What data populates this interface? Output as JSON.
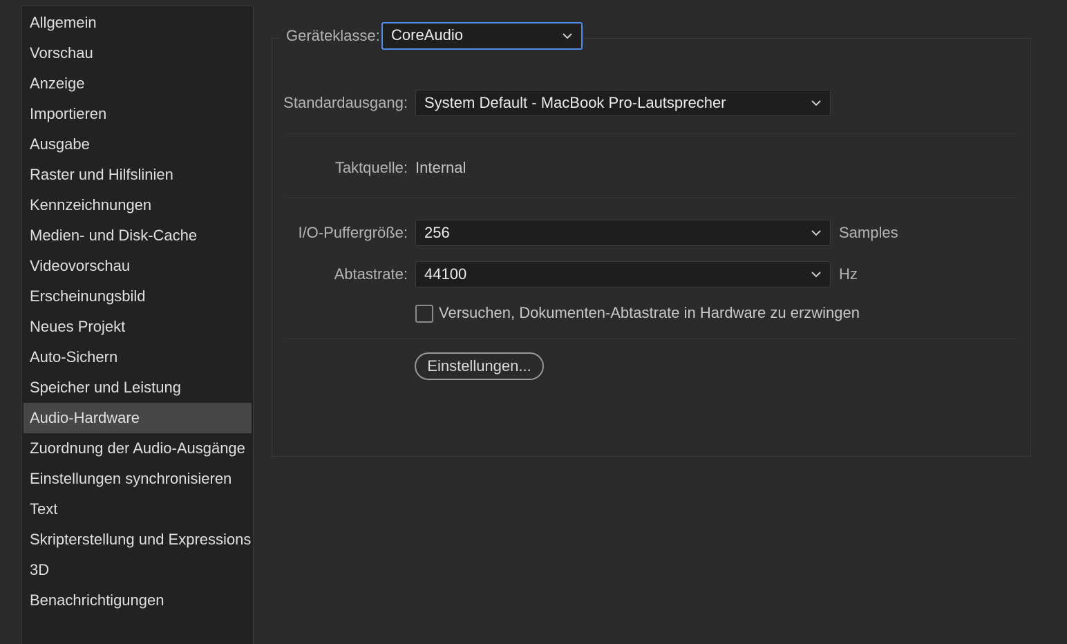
{
  "sidebar": {
    "items": [
      {
        "label": "Allgemein"
      },
      {
        "label": "Vorschau"
      },
      {
        "label": "Anzeige"
      },
      {
        "label": "Importieren"
      },
      {
        "label": "Ausgabe"
      },
      {
        "label": "Raster und Hilfslinien"
      },
      {
        "label": "Kennzeichnungen"
      },
      {
        "label": "Medien- und Disk-Cache"
      },
      {
        "label": "Videovorschau"
      },
      {
        "label": "Erscheinungsbild"
      },
      {
        "label": "Neues Projekt"
      },
      {
        "label": "Auto-Sichern"
      },
      {
        "label": "Speicher und Leistung"
      },
      {
        "label": "Audio-Hardware",
        "selected": true
      },
      {
        "label": "Zuordnung der Audio-Ausgänge"
      },
      {
        "label": "Einstellungen synchronisieren"
      },
      {
        "label": "Text"
      },
      {
        "label": "Skripterstellung und Expressions"
      },
      {
        "label": "3D"
      },
      {
        "label": "Benachrichtigungen"
      }
    ]
  },
  "audio_hardware": {
    "device_class": {
      "label": "Geräteklasse:",
      "value": "CoreAudio"
    },
    "default_output": {
      "label": "Standardausgang:",
      "value": "System Default - MacBook Pro-Lautsprecher"
    },
    "clock_source": {
      "label": "Taktquelle:",
      "value": "Internal"
    },
    "buffer_size": {
      "label": "I/O-Puffergröße:",
      "value": "256",
      "unit": "Samples"
    },
    "sample_rate": {
      "label": "Abtastrate:",
      "value": "44100",
      "unit": "Hz"
    },
    "force_rate_checkbox": {
      "label": "Versuchen, Dokumenten-Abtastrate in Hardware zu erzwingen",
      "checked": false
    },
    "settings_button": {
      "label": "Einstellungen..."
    }
  },
  "colors": {
    "background": "#2b2b2b",
    "sidebar_background": "#222222",
    "selected_item": "#474747",
    "focus_accent": "#4f8fe8"
  }
}
